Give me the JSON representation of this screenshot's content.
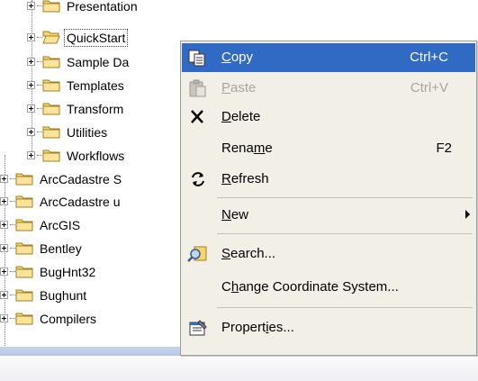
{
  "tree": {
    "items": [
      {
        "label": "Presentation",
        "open": false,
        "indent": 1
      },
      {
        "label": "QuickStart",
        "open": true,
        "indent": 1
      },
      {
        "label": "Sample Da",
        "open": false,
        "indent": 1
      },
      {
        "label": "Templates",
        "open": false,
        "indent": 1
      },
      {
        "label": "Transform",
        "open": false,
        "indent": 1
      },
      {
        "label": "Utilities",
        "open": false,
        "indent": 1
      },
      {
        "label": "Workflows",
        "open": false,
        "indent": 1
      },
      {
        "label": "ArcCadastre S",
        "open": false,
        "indent": 0
      },
      {
        "label": "ArcCadastre u",
        "open": false,
        "indent": 0
      },
      {
        "label": "ArcGIS",
        "open": false,
        "indent": 0
      },
      {
        "label": "Bentley",
        "open": false,
        "indent": 0
      },
      {
        "label": "BugHnt32",
        "open": false,
        "indent": 0
      },
      {
        "label": "Bughunt",
        "open": false,
        "indent": 0
      },
      {
        "label": "Compilers",
        "open": false,
        "indent": 0
      }
    ]
  },
  "menu": {
    "items": [
      {
        "pre": "",
        "key": "C",
        "post": "opy",
        "shortcut": "Ctrl+C",
        "icon": "copy-icon",
        "state": "highlighted"
      },
      {
        "pre": "",
        "key": "P",
        "post": "aste",
        "shortcut": "Ctrl+V",
        "icon": "paste-icon",
        "state": "disabled"
      },
      {
        "pre": "",
        "key": "D",
        "post": "elete",
        "shortcut": "",
        "icon": "delete-icon",
        "state": "normal"
      },
      {
        "pre": "Rena",
        "key": "m",
        "post": "e",
        "shortcut": "F2",
        "icon": "",
        "state": "normal"
      },
      {
        "pre": "",
        "key": "R",
        "post": "efresh",
        "shortcut": "",
        "icon": "refresh-icon",
        "state": "normal"
      },
      {
        "pre": "",
        "key": "N",
        "post": "ew",
        "shortcut": "",
        "icon": "",
        "state": "submenu"
      },
      {
        "pre": "",
        "key": "S",
        "post": "earch...",
        "shortcut": "",
        "icon": "search-icon",
        "state": "normal"
      },
      {
        "pre": "C",
        "key": "h",
        "post": "ange Coordinate System...",
        "shortcut": "",
        "icon": "",
        "state": "normal"
      },
      {
        "pre": "Propert",
        "key": "i",
        "post": "es...",
        "shortcut": "",
        "icon": "properties-icon",
        "state": "normal"
      }
    ]
  },
  "colors": {
    "highlight": "#316ac5",
    "menu_bg": "#f2efe7",
    "folder_yellow": "#f7d56b"
  }
}
